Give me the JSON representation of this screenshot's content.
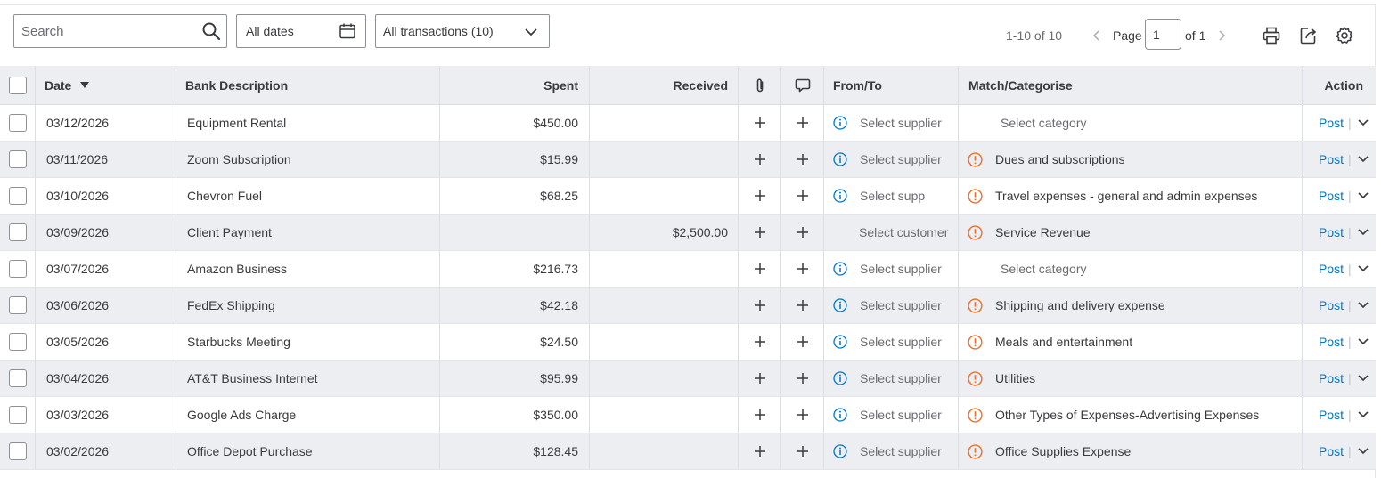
{
  "toolbar": {
    "search_placeholder": "Search",
    "dates_label": "All dates",
    "transactions_label": "All transactions (10)",
    "pager_count": "1-10 of 10",
    "page_label": "Page",
    "page_value": "1",
    "page_of": "of 1"
  },
  "columns": {
    "date": "Date",
    "description": "Bank Description",
    "spent": "Spent",
    "received": "Received",
    "from_to": "From/To",
    "match": "Match/Categorise",
    "action": "Action"
  },
  "rows": [
    {
      "date": "03/12/2026",
      "description": "Equipment Rental",
      "spent": "$450.00",
      "received": "",
      "from_to": "Select supplier",
      "from_icon": "info-icon",
      "match": "Select category",
      "match_icon": "",
      "action": "Post"
    },
    {
      "date": "03/11/2026",
      "description": "Zoom Subscription",
      "spent": "$15.99",
      "received": "",
      "from_to": "Select supplier",
      "from_icon": "info-icon",
      "match": "Dues and subscriptions",
      "match_icon": "warning-icon",
      "action": "Post"
    },
    {
      "date": "03/10/2026",
      "description": "Chevron Fuel",
      "spent": "$68.25",
      "received": "",
      "from_to": "Select supp",
      "from_icon": "info-icon",
      "match": "Travel expenses - general and admin expenses",
      "match_icon": "warning-icon",
      "action": "Post"
    },
    {
      "date": "03/09/2026",
      "description": "Client Payment",
      "spent": "",
      "received": "$2,500.00",
      "from_to": "Select customer",
      "from_icon": "",
      "match": "Service Revenue",
      "match_icon": "warning-icon",
      "action": "Post"
    },
    {
      "date": "03/07/2026",
      "description": "Amazon Business",
      "spent": "$216.73",
      "received": "",
      "from_to": "Select supplier",
      "from_icon": "info-icon",
      "match": "Select category",
      "match_icon": "",
      "action": "Post"
    },
    {
      "date": "03/06/2026",
      "description": "FedEx Shipping",
      "spent": "$42.18",
      "received": "",
      "from_to": "Select supplier",
      "from_icon": "info-icon",
      "match": "Shipping and delivery expense",
      "match_icon": "warning-icon",
      "action": "Post"
    },
    {
      "date": "03/05/2026",
      "description": "Starbucks Meeting",
      "spent": "$24.50",
      "received": "",
      "from_to": "Select supplier",
      "from_icon": "info-icon",
      "match": "Meals and entertainment",
      "match_icon": "warning-icon",
      "action": "Post"
    },
    {
      "date": "03/04/2026",
      "description": "AT&T Business Internet",
      "spent": "$95.99",
      "received": "",
      "from_to": "Select supplier",
      "from_icon": "info-icon",
      "match": "Utilities",
      "match_icon": "warning-icon",
      "action": "Post"
    },
    {
      "date": "03/03/2026",
      "description": "Google Ads Charge",
      "spent": "$350.00",
      "received": "",
      "from_to": "Select supplier",
      "from_icon": "info-icon",
      "match": "Other Types of Expenses-Advertising Expenses",
      "match_icon": "warning-icon",
      "action": "Post"
    },
    {
      "date": "03/02/2026",
      "description": "Office Depot Purchase",
      "spent": "$128.45",
      "received": "",
      "from_to": "Select supplier",
      "from_icon": "info-icon",
      "match": "Office Supplies Expense",
      "match_icon": "warning-icon",
      "action": "Post"
    }
  ],
  "colors": {
    "link": "#0077c5",
    "info": "#0077c5",
    "warning": "#e8702a",
    "header_bg": "#eceef1",
    "border": "#dcdee2"
  }
}
